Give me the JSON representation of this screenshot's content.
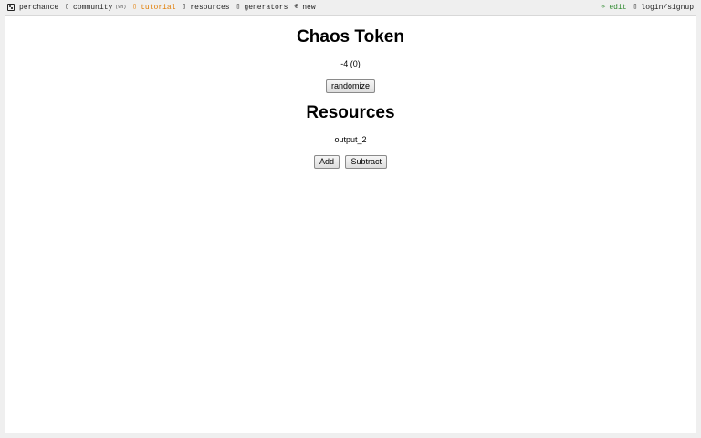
{
  "nav": {
    "left": [
      {
        "icon": "dice-icon",
        "label": "perchance"
      },
      {
        "icon": "community-icon",
        "label": "community",
        "badge": "(9h)"
      },
      {
        "icon": "tutorial-icon",
        "label": "tutorial"
      },
      {
        "icon": "resources-icon",
        "label": "resources"
      },
      {
        "icon": "generators-icon",
        "label": "generators"
      },
      {
        "icon": "plus-circle-icon",
        "label": "new"
      }
    ],
    "right": [
      {
        "icon": "pencil-icon",
        "label": "edit"
      },
      {
        "icon": "login-icon",
        "label": "login/signup"
      }
    ]
  },
  "main": {
    "chaos_title": "Chaos Token",
    "chaos_value": "-4 (0)",
    "randomize_label": "randomize",
    "resources_title": "Resources",
    "resources_value": "output_2",
    "add_label": "Add",
    "subtract_label": "Subtract"
  },
  "colors": {
    "tutorial": "#e07b00",
    "edit": "#2f8a2f"
  }
}
